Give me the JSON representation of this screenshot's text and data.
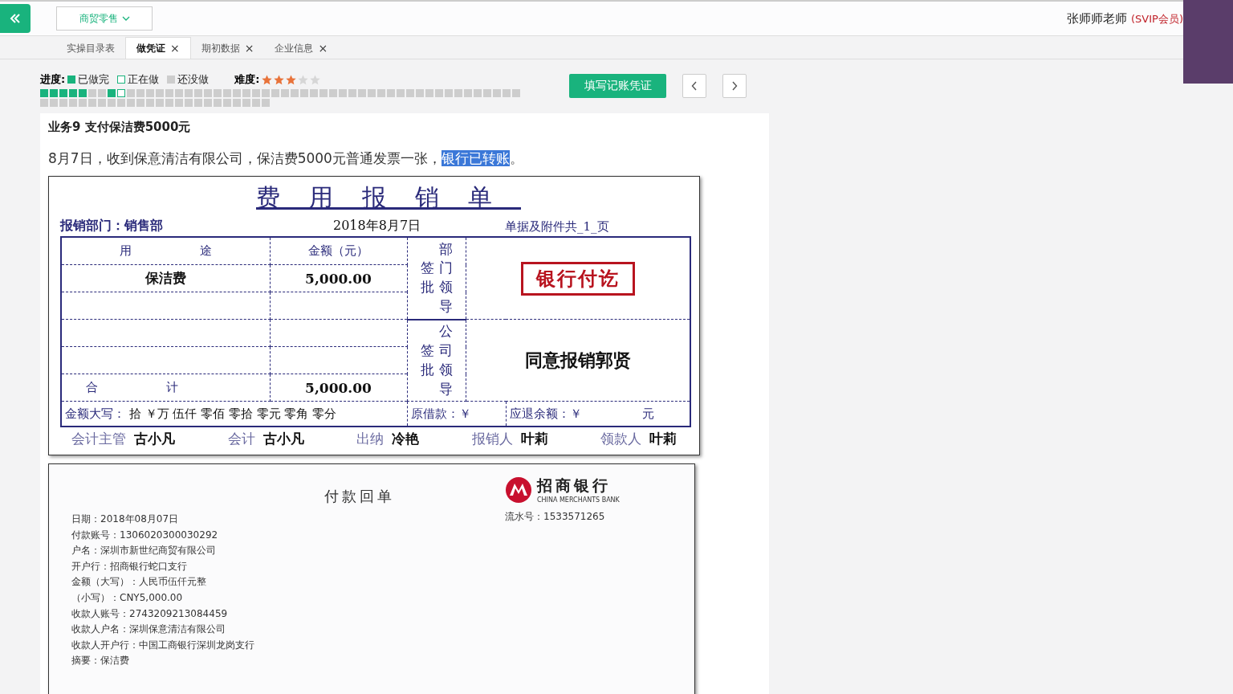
{
  "top_bar": {
    "menu": "商贸零售",
    "user_name": "张师师老师",
    "membership": "(SVIP会员)"
  },
  "tabs": [
    {
      "label": "实操目录表",
      "selected": false
    },
    {
      "label": "做凭证",
      "selected": true,
      "close": "×"
    },
    {
      "label": "期初数据",
      "selected": false,
      "close": "×"
    },
    {
      "label": "企业信息",
      "selected": false,
      "close": "×"
    }
  ],
  "progress": {
    "label": "进度:",
    "legend": [
      {
        "kind": "done",
        "label": "已做完"
      },
      {
        "kind": "current",
        "label": "正在做"
      },
      {
        "kind": "todo",
        "label": "还没做"
      }
    ],
    "cells": [
      {
        "kind": "done"
      },
      {
        "kind": "done"
      },
      {
        "kind": "done"
      },
      {
        "kind": "done"
      },
      {
        "kind": "done"
      },
      {
        "kind": "todo"
      },
      {
        "kind": "todo"
      },
      {
        "kind": "done"
      },
      {
        "kind": "current"
      },
      {
        "kind": "todo"
      },
      {
        "kind": "todo"
      },
      {
        "kind": "todo"
      },
      {
        "kind": "todo"
      },
      {
        "kind": "todo"
      },
      {
        "kind": "todo"
      },
      {
        "kind": "todo"
      },
      {
        "kind": "todo"
      },
      {
        "kind": "todo"
      },
      {
        "kind": "todo"
      },
      {
        "kind": "todo"
      },
      {
        "kind": "todo"
      },
      {
        "kind": "todo"
      },
      {
        "kind": "todo"
      },
      {
        "kind": "todo"
      },
      {
        "kind": "todo"
      },
      {
        "kind": "todo"
      },
      {
        "kind": "todo"
      },
      {
        "kind": "todo"
      },
      {
        "kind": "todo"
      },
      {
        "kind": "todo"
      },
      {
        "kind": "todo"
      },
      {
        "kind": "todo"
      },
      {
        "kind": "todo"
      },
      {
        "kind": "todo"
      },
      {
        "kind": "todo"
      },
      {
        "kind": "todo"
      },
      {
        "kind": "todo"
      },
      {
        "kind": "todo"
      },
      {
        "kind": "todo"
      },
      {
        "kind": "todo"
      },
      {
        "kind": "todo"
      },
      {
        "kind": "todo"
      },
      {
        "kind": "todo"
      },
      {
        "kind": "todo"
      },
      {
        "kind": "todo"
      },
      {
        "kind": "todo"
      },
      {
        "kind": "todo"
      },
      {
        "kind": "todo"
      },
      {
        "kind": "todo"
      },
      {
        "kind": "todo"
      },
      {
        "kind": "todo"
      },
      {
        "kind": "todo"
      },
      {
        "kind": "todo"
      },
      {
        "kind": "todo"
      },
      {
        "kind": "todo"
      },
      {
        "kind": "todo"
      },
      {
        "kind": "todo"
      },
      {
        "kind": "todo"
      },
      {
        "kind": "todo"
      },
      {
        "kind": "todo"
      },
      {
        "kind": "todo"
      },
      {
        "kind": "todo"
      },
      {
        "kind": "todo"
      },
      {
        "kind": "todo"
      },
      {
        "kind": "todo"
      },
      {
        "kind": "todo"
      },
      {
        "kind": "todo"
      },
      {
        "kind": "todo"
      },
      {
        "kind": "todo"
      },
      {
        "kind": "todo"
      },
      {
        "kind": "todo"
      },
      {
        "kind": "todo"
      },
      {
        "kind": "todo"
      },
      {
        "kind": "todo"
      }
    ]
  },
  "difficulty": {
    "label": "难度:",
    "stars": 3
  },
  "primary_button": "填写记账凭证",
  "task": {
    "title": "业务9 支付保洁费5000元",
    "description": [
      {
        "text": "8月7日，收到保意清洁有限公司，保洁费5000元普通发票一张，",
        "selected": false
      },
      {
        "text": "银行已转账",
        "selected": true
      },
      {
        "text": "。",
        "selected": false
      }
    ]
  },
  "expense_form": {
    "title": "费用报销单",
    "department": "报销部门：销售部",
    "date": "2018年8月7日",
    "attachments": "单据及附件共_1_页",
    "purpose_header": "用 途",
    "amount_header": "金额（元）",
    "rows": [
      {
        "purpose": "保洁费",
        "amount": "5,000.00"
      }
    ],
    "total_label": "合 计",
    "total": "5,000.00",
    "sign_label": "签批",
    "dept_leader": "部门领导",
    "company_sign_label": "签批",
    "company_leader": "公司领导",
    "stamp": "银行付讫",
    "approval": "同意报销郭贤",
    "amount_words_label": "金额大写：",
    "amount_words": "拾 ￥万 伍仟 零佰 零拾 零元 零角 零分",
    "loan": "原借款：￥",
    "refund": "应退余额：￥",
    "refund_unit": "元",
    "signatures": [
      {
        "role": "会计主管",
        "name": "古小凡"
      },
      {
        "role": "会计",
        "name": "古小凡"
      },
      {
        "role": "出纳",
        "name": "冷艳"
      },
      {
        "role": "报销人",
        "name": "叶莉"
      },
      {
        "role": "领款人",
        "name": "叶莉"
      }
    ]
  },
  "bank_receipt": {
    "title": "付款回单",
    "bank_name": "招商银行",
    "bank_english": "CHINA MERCHANTS BANK",
    "serial": "流水号：1533571265",
    "lines": [
      "日期：2018年08月07日",
      "付款账号：1306020300030292",
      "户名：深圳市新世纪商贸有限公司",
      "开户行：招商银行蛇口支行",
      "金额（大写）：人民币伍仟元整",
      "（小写）：CNY5,000.00",
      "收款人账号：2743209213084459",
      "收款人户名：深圳保意清洁有限公司",
      "收款人开户行：中国工商银行深圳龙岗支行",
      "摘要：保洁费"
    ]
  }
}
